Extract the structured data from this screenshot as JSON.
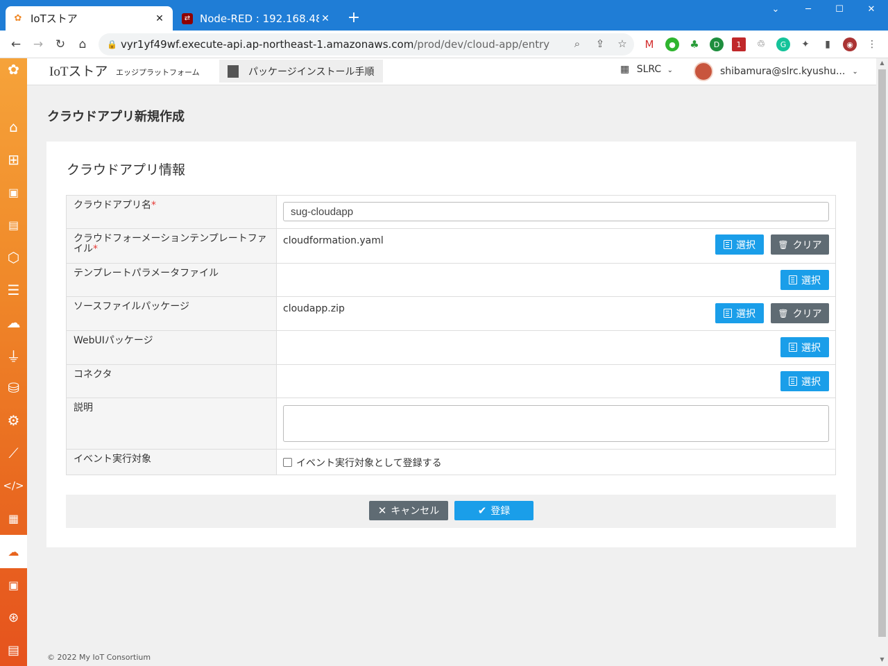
{
  "browser": {
    "tabs": [
      {
        "title": "IoTストア",
        "active": true
      },
      {
        "title": "Node-RED : 192.168.48",
        "active": false
      }
    ],
    "new_tab": "+",
    "url_host": "vyr1yf49wf.execute-api.ap-northeast-1.amazonaws.com",
    "url_path": "/prod/dev/cloud-app/entry"
  },
  "header": {
    "brand": "IoTストア",
    "brand_sub": "エッジプラットフォーム",
    "package_button": "パッケージインストール手順",
    "org": "SLRC",
    "user": "shibamura@slrc.kyushu..."
  },
  "page": {
    "title": "クラウドアプリ新規作成",
    "card_title": "クラウドアプリ情報"
  },
  "form": {
    "app_name_label": "クラウドアプリ名",
    "app_name_value": "sug-cloudapp",
    "cf_template_label": "クラウドフォーメーションテンプレートファイル",
    "cf_template_file": "cloudformation.yaml",
    "template_param_label": "テンプレートパラメータファイル",
    "source_pkg_label": "ソースファイルパッケージ",
    "source_pkg_file": "cloudapp.zip",
    "webui_pkg_label": "WebUIパッケージ",
    "connector_label": "コネクタ",
    "description_label": "説明",
    "event_label": "イベント実行対象",
    "event_checkbox_label": "イベント実行対象として登録する",
    "required_mark": "*",
    "select_label": "選択",
    "clear_label": "クリア"
  },
  "actions": {
    "cancel": "キャンセル",
    "submit": "登録"
  },
  "footer": {
    "copyright": "© 2022 My IoT Consortium"
  },
  "colors": {
    "titlebar": "#1f7dd6",
    "primary": "#1a9ee9",
    "secondary": "#5f6b73",
    "sidebar_top": "#f6a33a",
    "sidebar_bottom": "#e6531e",
    "required": "#e53935"
  }
}
